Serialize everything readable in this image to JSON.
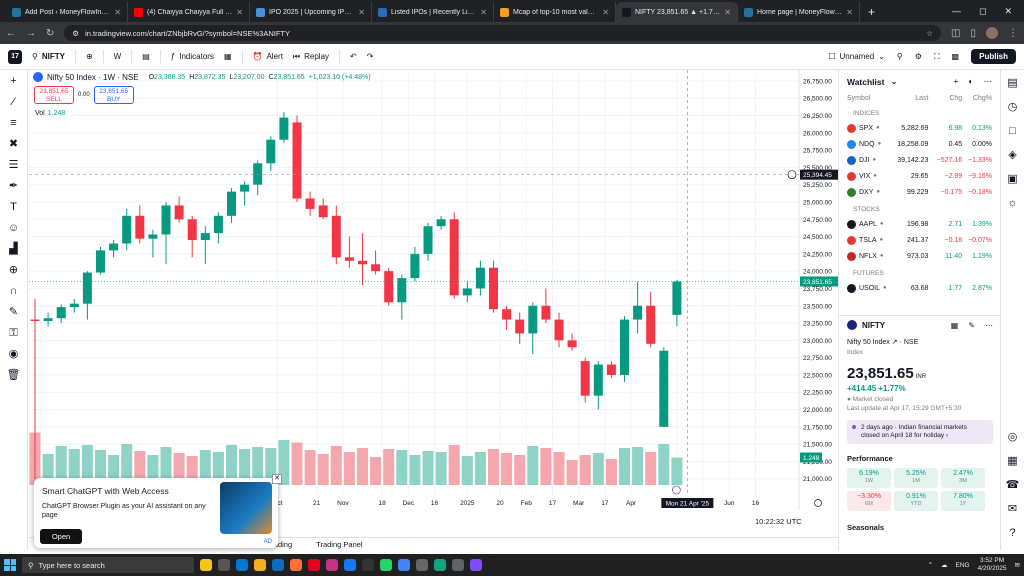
{
  "browser": {
    "tabs": [
      {
        "title": "Add Post ‹ MoneyFlowInsight —",
        "color": "#21759b",
        "active": false
      },
      {
        "title": "(4) Chaiyya Chaiyya Full Lyric...",
        "color": "#ff0000",
        "active": false
      },
      {
        "title": "IPO 2025 | Upcoming IPO | IPO...",
        "color": "#4a90d9",
        "active": false
      },
      {
        "title": "Listed IPOs | Recently Listed IPO...",
        "color": "#2d6cb5",
        "active": false
      },
      {
        "title": "Mcap of top-10 most valued fir...",
        "color": "#f4a020",
        "active": false
      },
      {
        "title": "NIFTY 23,851.65 ▲ +1.77% Un...",
        "color": "#131722",
        "active": true
      },
      {
        "title": "Home page | MoneyFlowInsight...",
        "color": "#21759b",
        "active": false
      }
    ],
    "url": "in.tradingview.com/chart/ZNbjbRvG/?symbol=NSE%3ANIFTY"
  },
  "toolbar": {
    "symbol": "NIFTY",
    "interval": "W",
    "indicators": "Indicators",
    "alert": "Alert",
    "replay": "Replay",
    "layout_name": "Unnamed",
    "publish": "Publish"
  },
  "legend": {
    "title": "Nifty 50 Index · 1W · NSE",
    "o_label": "O",
    "o": "23,368.35",
    "h_label": "H",
    "h": "23,872.35",
    "l_label": "L",
    "l": "23,207.00",
    "c_label": "C",
    "c": "23,851.65",
    "change": "+1,023.10 (+4.48%)",
    "sell_price": "23,851.65",
    "sell_label": "SELL",
    "spread": "0.00",
    "buy_price": "23,851.65",
    "buy_label": "BUY",
    "vol_label": "Vol",
    "vol_value": "1.248"
  },
  "chart_data": {
    "type": "candlestick",
    "ylim": [
      20750,
      26850
    ],
    "yticks": [
      21000,
      21250,
      21500,
      21750,
      22000,
      22250,
      22500,
      22750,
      23000,
      23250,
      23500,
      23750,
      24000,
      24250,
      24500,
      24750,
      25000,
      25250,
      25500,
      25750,
      26000,
      26250,
      26500,
      26750
    ],
    "xticks": [
      {
        "label": "Oct",
        "i": 18.5
      },
      {
        "label": "21",
        "i": 21.5
      },
      {
        "label": "Nov",
        "i": 23.5
      },
      {
        "label": "18",
        "i": 26.5
      },
      {
        "label": "Dec",
        "i": 28.5
      },
      {
        "label": "16",
        "i": 30.5
      },
      {
        "label": "2025",
        "i": 33
      },
      {
        "label": "20",
        "i": 35.5
      },
      {
        "label": "Feb",
        "i": 37.5
      },
      {
        "label": "17",
        "i": 39.5
      },
      {
        "label": "Mar",
        "i": 41.5
      },
      {
        "label": "17",
        "i": 43.5
      },
      {
        "label": "Apr",
        "i": 45.5
      },
      {
        "label": "May",
        "i": 49
      },
      {
        "label": "19",
        "i": 51
      },
      {
        "label": "Jun",
        "i": 53
      },
      {
        "label": "16",
        "i": 55
      }
    ],
    "crosshair_date": "Mon 21 Apr '25",
    "crosshair_price": "25,394.45",
    "last_price": "23,851.65",
    "last_volume": "1.248",
    "candles": [
      {
        "o": 23300,
        "h": 23600,
        "l": 21000,
        "c": 23280,
        "v": 1.05
      },
      {
        "o": 23280,
        "h": 23400,
        "l": 23200,
        "c": 23320,
        "v": 0.62
      },
      {
        "o": 23320,
        "h": 23520,
        "l": 23250,
        "c": 23480,
        "v": 0.78
      },
      {
        "o": 23480,
        "h": 23600,
        "l": 23400,
        "c": 23530,
        "v": 0.72
      },
      {
        "o": 23530,
        "h": 24000,
        "l": 23300,
        "c": 23980,
        "v": 0.8
      },
      {
        "o": 23980,
        "h": 24350,
        "l": 23950,
        "c": 24300,
        "v": 0.7
      },
      {
        "o": 24300,
        "h": 24450,
        "l": 24200,
        "c": 24400,
        "v": 0.6
      },
      {
        "o": 24400,
        "h": 24900,
        "l": 24300,
        "c": 24800,
        "v": 0.82
      },
      {
        "o": 24800,
        "h": 24950,
        "l": 24400,
        "c": 24470,
        "v": 0.68
      },
      {
        "o": 24470,
        "h": 24600,
        "l": 24200,
        "c": 24530,
        "v": 0.6
      },
      {
        "o": 24530,
        "h": 25000,
        "l": 24100,
        "c": 24950,
        "v": 0.76
      },
      {
        "o": 24950,
        "h": 25080,
        "l": 24700,
        "c": 24750,
        "v": 0.64
      },
      {
        "o": 24750,
        "h": 24800,
        "l": 24200,
        "c": 24450,
        "v": 0.58
      },
      {
        "o": 24450,
        "h": 24650,
        "l": 24100,
        "c": 24550,
        "v": 0.7
      },
      {
        "o": 24550,
        "h": 24850,
        "l": 24400,
        "c": 24800,
        "v": 0.66
      },
      {
        "o": 24800,
        "h": 25200,
        "l": 24700,
        "c": 25150,
        "v": 0.8
      },
      {
        "o": 25150,
        "h": 25300,
        "l": 24950,
        "c": 25250,
        "v": 0.72
      },
      {
        "o": 25250,
        "h": 25600,
        "l": 25100,
        "c": 25560,
        "v": 0.76
      },
      {
        "o": 25560,
        "h": 25950,
        "l": 25450,
        "c": 25900,
        "v": 0.74
      },
      {
        "o": 25900,
        "h": 26300,
        "l": 25850,
        "c": 26220,
        "v": 0.9
      },
      {
        "o": 26150,
        "h": 26250,
        "l": 25000,
        "c": 25050,
        "v": 0.85
      },
      {
        "o": 25050,
        "h": 25150,
        "l": 24800,
        "c": 24900,
        "v": 0.7
      },
      {
        "o": 24950,
        "h": 25050,
        "l": 24750,
        "c": 24780,
        "v": 0.62
      },
      {
        "o": 24800,
        "h": 24950,
        "l": 24100,
        "c": 24200,
        "v": 0.78
      },
      {
        "o": 24200,
        "h": 24500,
        "l": 24050,
        "c": 24150,
        "v": 0.66
      },
      {
        "o": 24150,
        "h": 24550,
        "l": 23800,
        "c": 24100,
        "v": 0.74
      },
      {
        "o": 24100,
        "h": 24300,
        "l": 23950,
        "c": 24000,
        "v": 0.56
      },
      {
        "o": 24000,
        "h": 24050,
        "l": 23500,
        "c": 23550,
        "v": 0.72
      },
      {
        "o": 23550,
        "h": 23950,
        "l": 23300,
        "c": 23900,
        "v": 0.7
      },
      {
        "o": 23900,
        "h": 24350,
        "l": 23850,
        "c": 24250,
        "v": 0.6
      },
      {
        "o": 24250,
        "h": 24700,
        "l": 24150,
        "c": 24650,
        "v": 0.68
      },
      {
        "o": 24650,
        "h": 24800,
        "l": 24600,
        "c": 24750,
        "v": 0.66
      },
      {
        "o": 24750,
        "h": 24850,
        "l": 23600,
        "c": 23650,
        "v": 0.8
      },
      {
        "o": 23650,
        "h": 23850,
        "l": 23550,
        "c": 23750,
        "v": 0.58
      },
      {
        "o": 23750,
        "h": 24150,
        "l": 23650,
        "c": 24050,
        "v": 0.66
      },
      {
        "o": 24050,
        "h": 24150,
        "l": 23400,
        "c": 23450,
        "v": 0.72
      },
      {
        "o": 23450,
        "h": 23500,
        "l": 23150,
        "c": 23300,
        "v": 0.64
      },
      {
        "o": 23300,
        "h": 23400,
        "l": 22950,
        "c": 23100,
        "v": 0.6
      },
      {
        "o": 23100,
        "h": 23550,
        "l": 22800,
        "c": 23500,
        "v": 0.78
      },
      {
        "o": 23500,
        "h": 23750,
        "l": 23250,
        "c": 23300,
        "v": 0.74
      },
      {
        "o": 23300,
        "h": 23400,
        "l": 22900,
        "c": 23000,
        "v": 0.66
      },
      {
        "o": 23000,
        "h": 23100,
        "l": 22850,
        "c": 22900,
        "v": 0.5
      },
      {
        "o": 22700,
        "h": 22750,
        "l": 22100,
        "c": 22200,
        "v": 0.6
      },
      {
        "o": 22200,
        "h": 22700,
        "l": 22000,
        "c": 22650,
        "v": 0.64
      },
      {
        "o": 22650,
        "h": 22700,
        "l": 22450,
        "c": 22500,
        "v": 0.52
      },
      {
        "o": 22500,
        "h": 23350,
        "l": 22400,
        "c": 23300,
        "v": 0.74
      },
      {
        "o": 23300,
        "h": 23850,
        "l": 23100,
        "c": 23500,
        "v": 0.76
      },
      {
        "o": 23500,
        "h": 23700,
        "l": 22900,
        "c": 22950,
        "v": 0.66
      },
      {
        "o": 21750,
        "h": 22900,
        "l": 21750,
        "c": 22850,
        "v": 0.82
      },
      {
        "o": 23368,
        "h": 23872,
        "l": 23207,
        "c": 23851,
        "v": 0.55
      }
    ]
  },
  "clock_text": "10:22:32 UTC",
  "bottom_tabs": [
    "Trading",
    "Trading Panel"
  ],
  "ad": {
    "title": "Smart ChatGPT with Web Access",
    "text": "ChatGPT Browser Plugin as your AI assistant on any page",
    "button": "Open",
    "badge": "AD"
  },
  "watchlist": {
    "title": "Watchlist",
    "cols": [
      "Symbol",
      "Last",
      "Chg",
      "Chg%"
    ],
    "sections": [
      {
        "name": "INDICES",
        "rows": [
          {
            "sym": "SPX",
            "last": "5,282.69",
            "chg": "6.98",
            "pct": "0.13%",
            "dir": "up",
            "color": "#e53935"
          },
          {
            "sym": "NDQ",
            "last": "18,258.09",
            "chg": "0.45",
            "pct": "0.00%",
            "dir": "flat",
            "color": "#1e88e5"
          },
          {
            "sym": "DJI",
            "last": "39,142.23",
            "chg": "−527.16",
            "pct": "−1.33%",
            "dir": "down",
            "color": "#1565c0"
          },
          {
            "sym": "VIX",
            "last": "29.65",
            "chg": "−2.99",
            "pct": "−9.16%",
            "dir": "down",
            "color": "#e53935"
          },
          {
            "sym": "DXY",
            "last": "99.229",
            "chg": "−0.175",
            "pct": "−0.18%",
            "dir": "down",
            "color": "#2e7d32"
          }
        ]
      },
      {
        "name": "STOCKS",
        "rows": [
          {
            "sym": "AAPL",
            "last": "196.98",
            "chg": "2.71",
            "pct": "1.39%",
            "dir": "up",
            "color": "#131722"
          },
          {
            "sym": "TSLA",
            "last": "241.37",
            "chg": "−0.18",
            "pct": "−0.07%",
            "dir": "down",
            "color": "#e53935"
          },
          {
            "sym": "NFLX",
            "last": "973.03",
            "chg": "11.40",
            "pct": "1.19%",
            "dir": "up",
            "color": "#c62828"
          }
        ]
      },
      {
        "name": "FUTURES",
        "rows": [
          {
            "sym": "USOIL",
            "last": "63.68",
            "chg": "1.77",
            "pct": "2.87%",
            "dir": "up",
            "color": "#131722"
          }
        ]
      }
    ]
  },
  "detail": {
    "symbol": "NIFTY",
    "name": "Nifty 50 Index",
    "exchange": "NSE",
    "type": "Index",
    "price": "23,851.65",
    "currency": "INR",
    "change": "+414.45  +1.77%",
    "status": "Market closed",
    "updated": "Last update at Apr 17, 15:29 GMT+5:30",
    "news": "2 days ago · Indian financial markets closed on April 18 for holiday",
    "perf_title": "Performance",
    "perf": [
      {
        "v": "6.19%",
        "p": "1W",
        "dir": "pos"
      },
      {
        "v": "5.25%",
        "p": "1M",
        "dir": "pos"
      },
      {
        "v": "2.47%",
        "p": "3M",
        "dir": "pos"
      },
      {
        "v": "−3.30%",
        "p": "6M",
        "dir": "neg"
      },
      {
        "v": "0.91%",
        "p": "YTD",
        "dir": "pos"
      },
      {
        "v": "7.80%",
        "p": "1Y",
        "dir": "pos"
      }
    ],
    "seasonals": "Seasonals"
  },
  "taskbar": {
    "search": "Type here to search",
    "lang": "ENG",
    "time": "3:52 PM",
    "date": "4/20/2025"
  }
}
